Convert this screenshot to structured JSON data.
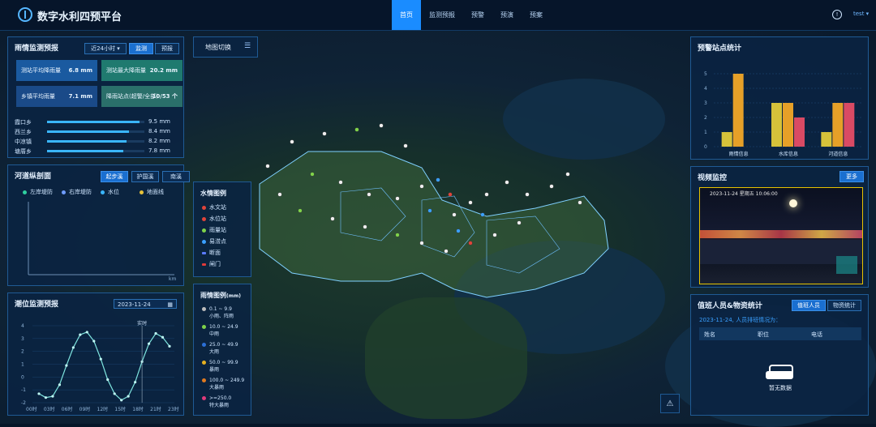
{
  "header": {
    "title": "数字水利四预平台",
    "nav": [
      "首页",
      "监测预报",
      "预警",
      "预演",
      "预案"
    ],
    "active_index": 0,
    "user": "test"
  },
  "rain_panel": {
    "title": "雨情监测预报",
    "range_select": "近24小时",
    "btn_monitor": "监测",
    "btn_forecast": "预报",
    "stats": [
      {
        "label": "测站平均降雨量",
        "value": "6.8 mm"
      },
      {
        "label": "测站最大降雨量",
        "value": "20.2 mm"
      },
      {
        "label": "乡镇平均雨量",
        "value": "7.1 mm"
      },
      {
        "label": "降雨站点(超警/全部)",
        "value": "10/53 个"
      }
    ],
    "stations": [
      {
        "name": "霞口乡",
        "value": "9.5 mm",
        "ratio": 0.95
      },
      {
        "name": "西兰乡",
        "value": "8.4 mm",
        "ratio": 0.84
      },
      {
        "name": "中凉镇",
        "value": "8.2 mm",
        "ratio": 0.82
      },
      {
        "name": "塘厝乡",
        "value": "7.8 mm",
        "ratio": 0.78
      }
    ]
  },
  "river_panel": {
    "title": "河道纵剖面",
    "tabs": [
      "起步溪",
      "护国溪",
      "南溪"
    ],
    "legend": [
      "左岸堤防",
      "右岸堤防",
      "水位",
      "地面线"
    ],
    "unit": "km"
  },
  "tide_panel": {
    "title": "潮位监测预报",
    "date": "2023-11-24",
    "marker_label": "实时",
    "y_ticks": [
      "4",
      "3",
      "2",
      "1",
      "0",
      "-1",
      "-2"
    ],
    "x_ticks": [
      "00时",
      "03时",
      "06时",
      "09时",
      "12时",
      "15时",
      "18时",
      "21时",
      "23时"
    ],
    "values": [
      -1.3,
      -1.6,
      -1.5,
      -0.6,
      0.9,
      2.3,
      3.3,
      3.5,
      2.8,
      1.4,
      -0.2,
      -1.3,
      -1.8,
      -1.5,
      -0.4,
      1.2,
      2.6,
      3.4,
      3.1,
      2.4
    ]
  },
  "map_switch": {
    "label": "地图切换"
  },
  "water_legend": {
    "title": "水情图例",
    "items": [
      {
        "label": "水文站",
        "color": "#e0443a"
      },
      {
        "label": "水位站",
        "color": "#e0443a"
      },
      {
        "label": "雨量站",
        "color": "#7fd34a"
      },
      {
        "label": "易涝点",
        "color": "#3aa0ff"
      },
      {
        "label": "断面",
        "color": "#5b7cff"
      },
      {
        "label": "闸门",
        "color": "#e03a3a"
      }
    ]
  },
  "rain_legend": {
    "title": "雨情图例",
    "unit": "(mm)",
    "items": [
      {
        "range": "0.1 ~ 9.9",
        "name": "小雨、阵雨",
        "color": "#bdbdbd"
      },
      {
        "range": "10.0 ~ 24.9",
        "name": "中雨",
        "color": "#7fd34a"
      },
      {
        "range": "25.0 ~ 49.9",
        "name": "大雨",
        "color": "#2b6fd6"
      },
      {
        "range": "50.0 ~ 99.9",
        "name": "暴雨",
        "color": "#e6b020"
      },
      {
        "range": "100.0 ~ 249.9",
        "name": "大暴雨",
        "color": "#e07a20"
      },
      {
        "range": ">=250.0",
        "name": "特大暴雨",
        "color": "#e03a7a"
      }
    ]
  },
  "warn_panel": {
    "title": "预警站点统计",
    "y_ticks": [
      "5",
      "4",
      "3",
      "2",
      "1",
      "0"
    ],
    "ylim": [
      0,
      5
    ],
    "chart_data": {
      "type": "bar",
      "categories": [
        "雨情信息",
        "水库信息",
        "河道信息"
      ],
      "series": [
        {
          "name": "",
          "values": [
            1,
            3,
            1
          ],
          "color": "#d6c23a"
        },
        {
          "name": "",
          "values": [
            5,
            3,
            3
          ],
          "color": "#e6a028"
        },
        {
          "name": "",
          "values": [
            0,
            2,
            3
          ],
          "color": "#d94a64"
        }
      ]
    }
  },
  "video_panel": {
    "title": "视频监控",
    "more": "更多",
    "timestamp": "2023-11-24 星期五 10:06:00"
  },
  "duty_panel": {
    "title": "值班人员&物资统计",
    "tabs": [
      "值班人员",
      "物资统计"
    ],
    "subtitle": "2023-11-24, 人员排班情况为：",
    "columns": [
      "姓名",
      "职位",
      "电话"
    ],
    "empty": "暂无数据"
  }
}
